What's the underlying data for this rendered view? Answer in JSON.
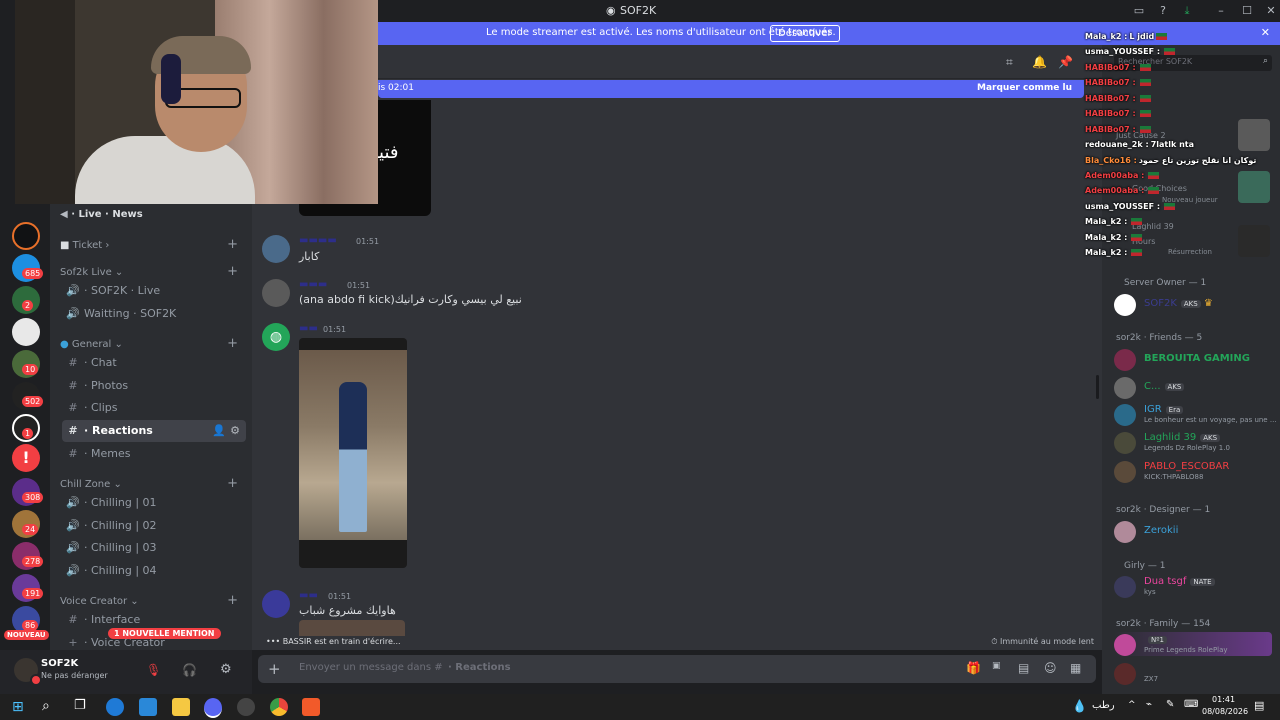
{
  "window": {
    "title": "SOF2K"
  },
  "banner": {
    "message": "Le mode streamer est activé. Les noms d'utilisateur ont été tronqués.",
    "button": "Désactiver"
  },
  "rail_badges": [
    "685",
    "2",
    "10",
    "502",
    "1",
    "308",
    "24",
    "278",
    "191",
    "86"
  ],
  "rail_new_label": "NOUVEAU",
  "channels": {
    "top_item": "· Live · News",
    "categories": [
      {
        "label": "Ticket"
      },
      {
        "label": "Sof2k Live"
      },
      {
        "label": "General"
      },
      {
        "label": "Chill Zone"
      },
      {
        "label": "Voice Creator"
      }
    ],
    "items": [
      {
        "label": "· SOF2K · Live"
      },
      {
        "label": "Waitting · SOF2K"
      },
      {
        "label": "· Chat"
      },
      {
        "label": "· Photos"
      },
      {
        "label": "· Clips"
      },
      {
        "label": "· Reactions"
      },
      {
        "label": "· Memes"
      },
      {
        "label": "· Chilling | 01"
      },
      {
        "label": "· Chilling | 02"
      },
      {
        "label": "· Chilling | 03"
      },
      {
        "label": "· Chilling | 04"
      },
      {
        "label": "· Interface"
      },
      {
        "label": "· Voice Creator"
      }
    ],
    "mention_pill": "1 NOUVELLE MENTION"
  },
  "user": {
    "name": "SOF2K",
    "status": "Ne pas déranger"
  },
  "chat": {
    "new_bar_left": "is 02:01",
    "new_bar_right": "Marquer comme lu",
    "image_text": "فتيزي",
    "messages": [
      {
        "time": "01:51",
        "text": "كابار"
      },
      {
        "time": "01:51",
        "text": "(ana abdo fi kick)نبيع لي بيسي وكارت فرانيك"
      },
      {
        "time": "01:51",
        "text": ""
      },
      {
        "time": "01:51",
        "text": "هاوايك مشروع شباب"
      }
    ],
    "typing": "BASSIR est en train d'écrire...",
    "slowmode": "Immunité au mode lent",
    "composer_placeholder": "Envoyer un message dans #",
    "composer_channel": "· Reactions"
  },
  "members_search": "Rechercher SOF2K",
  "members": {
    "sections": [
      {
        "title": "Server Owner — 1"
      },
      {
        "title": "sor2k · Friends — 5"
      },
      {
        "title": "sor2k · Designer — 1"
      },
      {
        "title": "Girly — 1"
      },
      {
        "title": "sor2k · Family — 154"
      }
    ],
    "people": [
      {
        "name": "SOF2K",
        "tag": "AKS",
        "status": "",
        "color": "#3b3d8f"
      },
      {
        "name": "BEROUITA GAMING",
        "tag": "",
        "status": "",
        "color": "#23a559"
      },
      {
        "name": "C...",
        "tag": "AKS",
        "status": "",
        "color": "#23a559"
      },
      {
        "name": "IGR",
        "tag": "Era",
        "status": "Le bonheur est un voyage, pas une ...",
        "color": "#3ba1d9"
      },
      {
        "name": "Laghlid 39",
        "tag": "AKS",
        "status": "Legends Dz RolePlay 1.0",
        "color": "#23a559"
      },
      {
        "name": "PABLO_ESCOBAR",
        "tag": "",
        "status": "KICK:THPABLO88",
        "color": "#f23f43"
      },
      {
        "name": "Zerokii",
        "tag": "",
        "status": "",
        "color": "#3ba1d9"
      },
      {
        "name": "Dua tsgf",
        "tag": "NATE",
        "status": "kys",
        "color": "#eb459e"
      },
      {
        "name": "",
        "tag": "Nº1",
        "status": "Prime Legends RolePlay",
        "color": "#eb459e"
      },
      {
        "name": "",
        "tag": "",
        "status": "ZX7",
        "color": "#3b3d8f"
      }
    ]
  },
  "overlay": {
    "lines": [
      {
        "user": "Mala_k2 :",
        "text": "L jdid",
        "color": "#ffffff"
      },
      {
        "user": "usma_YOUSSEF :",
        "text": "",
        "color": "#ffffff"
      },
      {
        "user": "HABIBo07 :",
        "text": "",
        "color": "#f23f43"
      },
      {
        "user": "HABIBo07 :",
        "text": "",
        "color": "#f23f43"
      },
      {
        "user": "HABIBo07 :",
        "text": "",
        "color": "#f23f43"
      },
      {
        "user": "HABIBo07 :",
        "text": "",
        "color": "#f23f43"
      },
      {
        "user": "HABIBo07 :",
        "text": "",
        "color": "#f23f43"
      },
      {
        "user": "redouane_2k :",
        "text": "7latlk nta",
        "color": "#ffffff"
      },
      {
        "user": "Bla_Cko16 :",
        "text": "توكان انا نقلج توزين تاع حمود",
        "color": "#ff8c3a"
      },
      {
        "user": "Adem00aba :",
        "text": "",
        "color": "#f23f43"
      },
      {
        "user": "Adem00aba :",
        "text": "",
        "color": "#f23f43"
      },
      {
        "user": "usma_YOUSSEF :",
        "text": "",
        "color": "#ffffff"
      },
      {
        "user": "Mala_k2 :",
        "text": "",
        "color": "#ffffff"
      },
      {
        "user": "Mala_k2 :",
        "text": "",
        "color": "#ffffff"
      },
      {
        "user": "Mala_k2 :",
        "text": "",
        "color": "#ffffff"
      }
    ]
  },
  "ghost_activity": [
    "Just Cause 2",
    "Good Choices",
    "Nouveau joueur",
    "Laghlid 39",
    "Hours",
    "Résurrection"
  ],
  "taskbar": {
    "weather": "رطب",
    "time": "01:41",
    "date": "08/08/2026"
  },
  "colors": {
    "accent": "#5865f2",
    "online": "#23a559",
    "dnd": "#f23f43"
  }
}
